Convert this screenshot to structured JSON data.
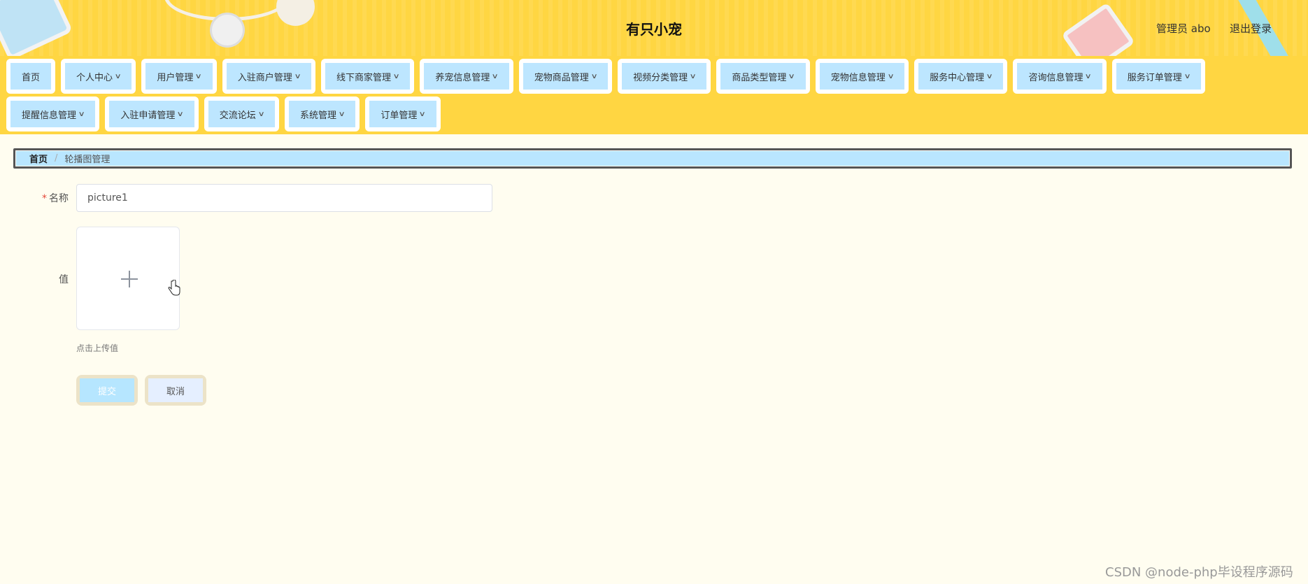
{
  "header": {
    "title": "有只小宠",
    "admin_label": "管理员 abo",
    "logout_label": "退出登录",
    "background_color": "#ffd642"
  },
  "nav": {
    "row1": [
      {
        "label": "首页",
        "has_dropdown": false
      },
      {
        "label": "个人中心",
        "has_dropdown": true
      },
      {
        "label": "用户管理",
        "has_dropdown": true
      },
      {
        "label": "入驻商户管理",
        "has_dropdown": true
      },
      {
        "label": "线下商家管理",
        "has_dropdown": true
      },
      {
        "label": "养宠信息管理",
        "has_dropdown": true
      },
      {
        "label": "宠物商品管理",
        "has_dropdown": true
      },
      {
        "label": "视频分类管理",
        "has_dropdown": true
      },
      {
        "label": "商品类型管理",
        "has_dropdown": true
      },
      {
        "label": "宠物信息管理",
        "has_dropdown": true
      },
      {
        "label": "服务中心管理",
        "has_dropdown": true
      },
      {
        "label": "咨询信息管理",
        "has_dropdown": true
      },
      {
        "label": "服务订单管理",
        "has_dropdown": true
      }
    ],
    "row2": [
      {
        "label": "提醒信息管理",
        "has_dropdown": true
      },
      {
        "label": "入驻申请管理",
        "has_dropdown": true
      },
      {
        "label": "交流论坛",
        "has_dropdown": true
      },
      {
        "label": "系统管理",
        "has_dropdown": true
      },
      {
        "label": "订单管理",
        "has_dropdown": true
      }
    ],
    "item_color": "#bde6ff"
  },
  "breadcrumb": {
    "home": "首页",
    "separator": "/",
    "current": "轮播图管理"
  },
  "form": {
    "name_label": "名称",
    "required_mark": "*",
    "name_value": "picture1",
    "value_label": "值",
    "upload_tip": "点击上传值",
    "submit_label": "提交",
    "cancel_label": "取消"
  },
  "watermark": "CSDN @node-php毕设程序源码"
}
